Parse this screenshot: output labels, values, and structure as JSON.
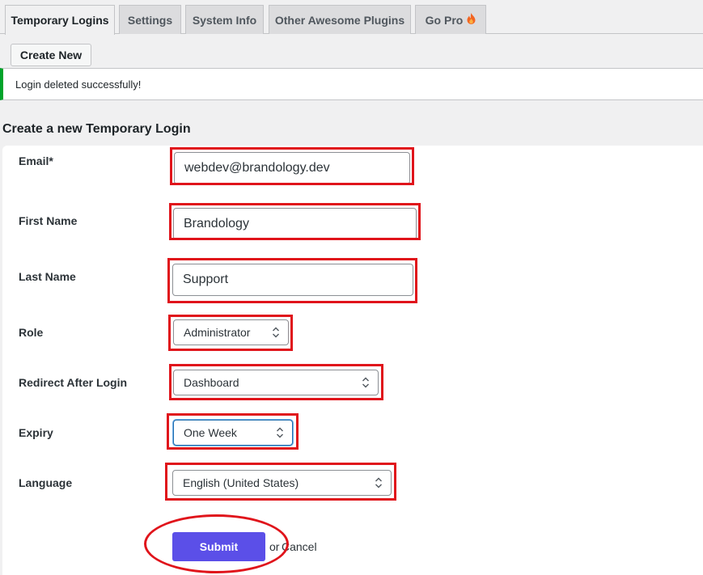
{
  "tabs": [
    {
      "label": "Temporary Logins",
      "active": true
    },
    {
      "label": "Settings",
      "active": false
    },
    {
      "label": "System Info",
      "active": false
    },
    {
      "label": "Other Awesome Plugins",
      "active": false
    },
    {
      "label": "Go Pro",
      "active": false,
      "icon": "flame-icon"
    }
  ],
  "toolbar": {
    "create_new_label": "Create New"
  },
  "notice": {
    "text": "Login deleted successfully!",
    "color": "#00a32a"
  },
  "form": {
    "title": "Create a new Temporary Login",
    "email": {
      "label": "Email*",
      "value": "webdev@brandology.dev"
    },
    "first_name": {
      "label": "First Name",
      "value": "Brandology"
    },
    "last_name": {
      "label": "Last Name",
      "value": "Support"
    },
    "role": {
      "label": "Role",
      "value": "Administrator"
    },
    "redirect": {
      "label": "Redirect After Login",
      "value": "Dashboard"
    },
    "expiry": {
      "label": "Expiry",
      "value": "One Week"
    },
    "language": {
      "label": "Language",
      "value": "English (United States)"
    },
    "submit_label": "Submit",
    "or_text": "or",
    "cancel_label": "Cancel"
  },
  "colors": {
    "highlight": "#e0141b",
    "submit_bg": "#5b4fe8",
    "notice_border": "#00a32a"
  }
}
